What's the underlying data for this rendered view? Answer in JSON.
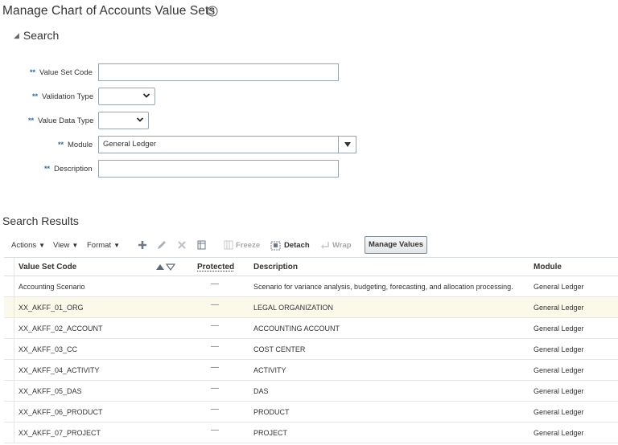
{
  "page": {
    "title": "Manage Chart of Accounts Value Sets"
  },
  "search": {
    "header": "Search",
    "fields": {
      "value_set_code": {
        "label": "Value Set Code",
        "value": ""
      },
      "validation_type": {
        "label": "Validation Type",
        "value": ""
      },
      "value_data_type": {
        "label": "Value Data Type",
        "value": ""
      },
      "module": {
        "label": "Module",
        "value": "General Ledger"
      },
      "description": {
        "label": "Description",
        "value": ""
      }
    },
    "required_marker": "**"
  },
  "results": {
    "title": "Search Results",
    "toolbar": {
      "actions": "Actions",
      "view": "View",
      "format": "Format",
      "freeze": "Freeze",
      "detach": "Detach",
      "wrap": "Wrap",
      "manage_values": "Manage Values"
    },
    "columns": {
      "code": "Value Set Code",
      "protected": "Protected",
      "description": "Description",
      "module": "Module"
    },
    "rows": [
      {
        "code": "Accounting Scenario",
        "protected": "—",
        "description": "Scenario for variance analysis, budgeting, forecasting, and allocation processing.",
        "module": "General Ledger",
        "selected": false
      },
      {
        "code": "XX_AKFF_01_ORG",
        "protected": "—",
        "description": "LEGAL ORGANIZATION",
        "module": "General Ledger",
        "selected": true
      },
      {
        "code": "XX_AKFF_02_ACCOUNT",
        "protected": "—",
        "description": "ACCOUNTING ACCOUNT",
        "module": "General Ledger",
        "selected": false
      },
      {
        "code": "XX_AKFF_03_CC",
        "protected": "—",
        "description": "COST CENTER",
        "module": "General Ledger",
        "selected": false
      },
      {
        "code": "XX_AKFF_04_ACTIVITY",
        "protected": "—",
        "description": "ACTIVITY",
        "module": "General Ledger",
        "selected": false
      },
      {
        "code": "XX_AKFF_05_DAS",
        "protected": "—",
        "description": "DAS",
        "module": "General Ledger",
        "selected": false
      },
      {
        "code": "XX_AKFF_06_PRODUCT",
        "protected": "—",
        "description": "PRODUCT",
        "module": "General Ledger",
        "selected": false
      },
      {
        "code": "XX_AKFF_07_PROJECT",
        "protected": "—",
        "description": "PROJECT",
        "module": "General Ledger",
        "selected": false
      }
    ]
  },
  "colors": {
    "required_marker": "#1f6cb8",
    "selected_row": "#fbf9ea",
    "input_border": "#9aa4ad"
  },
  "icons": [
    "help-icon",
    "collapse-triangle-icon",
    "add-icon",
    "edit-icon",
    "delete-icon",
    "query-by-example-icon",
    "freeze-icon",
    "detach-icon",
    "wrap-icon",
    "sort-ascending-icon",
    "sort-descending-icon",
    "chevron-down-icon"
  ]
}
